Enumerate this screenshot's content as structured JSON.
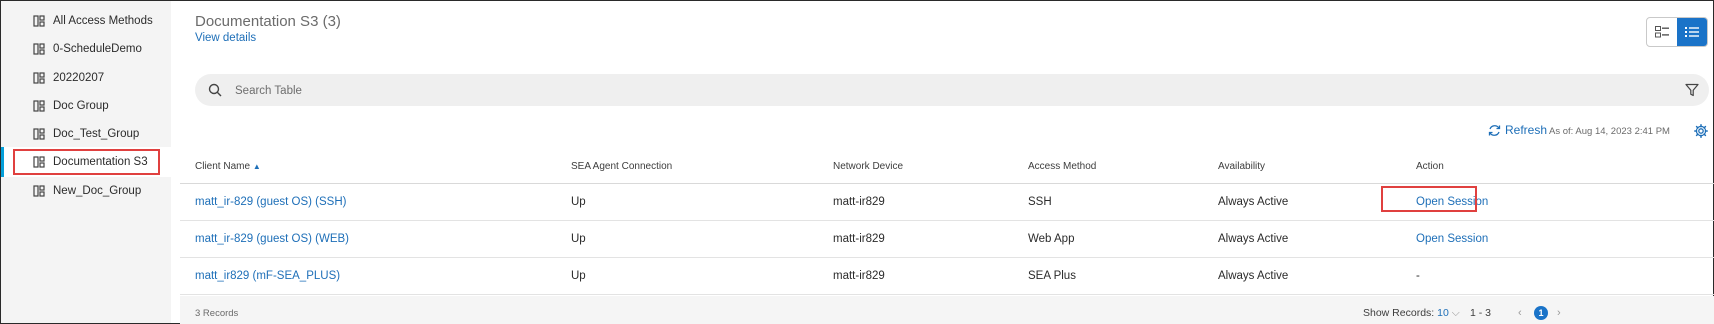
{
  "sidebar": {
    "items": [
      {
        "label": "All Access Methods"
      },
      {
        "label": "0-ScheduleDemo"
      },
      {
        "label": "20220207"
      },
      {
        "label": "Doc Group"
      },
      {
        "label": "Doc_Test_Group"
      },
      {
        "label": "Documentation S3"
      },
      {
        "label": "New_Doc_Group"
      }
    ]
  },
  "header": {
    "title": "Documentation S3 (3)",
    "view_details": "View details"
  },
  "search": {
    "placeholder": "Search Table"
  },
  "toolbar": {
    "refresh_label": "Refresh",
    "as_of": "As of: Aug 14, 2023 2:41 PM"
  },
  "table": {
    "columns": [
      "Client Name",
      "SEA Agent Connection",
      "Network Device",
      "Access Method",
      "Availability",
      "Action"
    ],
    "rows": [
      {
        "client": "matt_ir-829 (guest OS) (SSH)",
        "sea": "Up",
        "device": "matt-ir829",
        "method": "SSH",
        "availability": "Always Active",
        "action": "Open Session"
      },
      {
        "client": "matt_ir-829 (guest OS) (WEB)",
        "sea": "Up",
        "device": "matt-ir829",
        "method": "Web App",
        "availability": "Always Active",
        "action": "Open Session"
      },
      {
        "client": "matt_ir829 (mF-SEA_PLUS)",
        "sea": "Up",
        "device": "matt-ir829",
        "method": "SEA Plus",
        "availability": "Always Active",
        "action": "-"
      }
    ]
  },
  "footer": {
    "records": "3 Records",
    "show_records_label": "Show Records:",
    "show_records_value": "10",
    "range": "1 - 3",
    "current_page": "1"
  },
  "colors": {
    "accent": "#1a73c8",
    "link": "#1e6fb8",
    "highlight": "#e0403f"
  }
}
